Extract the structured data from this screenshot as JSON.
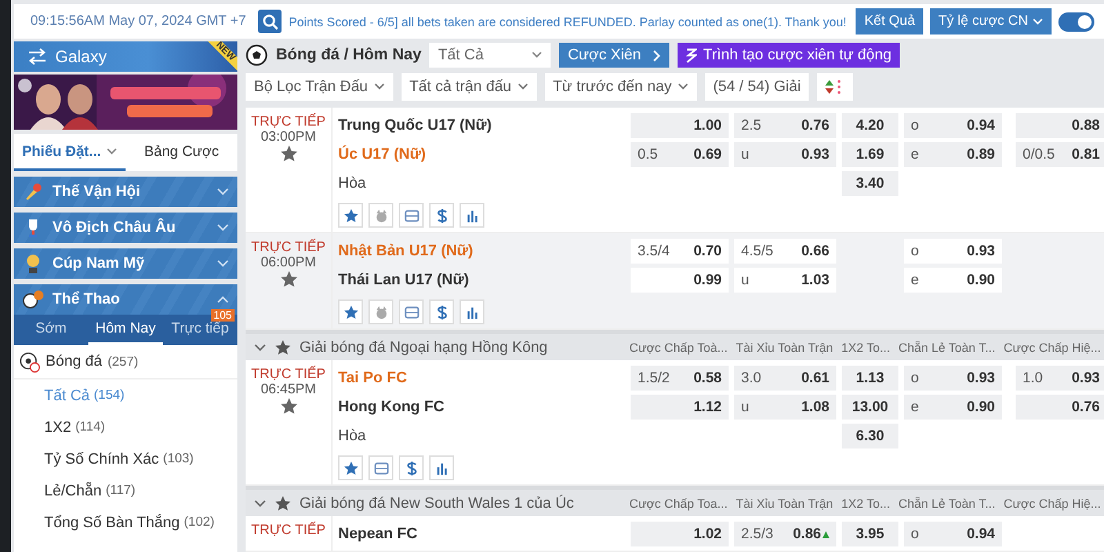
{
  "top_bar": {
    "clock": "09:15:56AM May 07, 2024 GMT +7",
    "ticker": "Points Scored - 6/5] all bets taken are considered REFUNDED. Parlay counted as one(1). Thank you!",
    "buttons": [
      {
        "label": "Kết Quả",
        "dropdown": false
      },
      {
        "label": "Tỷ lệ cược CN",
        "dropdown": true
      }
    ],
    "toggle": {
      "on": true
    }
  },
  "sidebar": {
    "galaxy": {
      "label": "Galaxy",
      "ribbon": "NEW"
    },
    "tabs": [
      {
        "label": "Phiếu Đặt...",
        "selected": true,
        "dropdown": true
      },
      {
        "label": "Bảng Cược",
        "selected": false,
        "dropdown": false
      }
    ],
    "categories": [
      {
        "label": "Thế Vận Hội",
        "expanded": false
      },
      {
        "label": "Vô Địch Châu Âu",
        "expanded": false
      },
      {
        "label": "Cúp Nam Mỹ",
        "expanded": false
      },
      {
        "label": "Thể Thao",
        "expanded": true
      }
    ],
    "sub_tabs": [
      {
        "label": "Sớm",
        "selected": false
      },
      {
        "label": "Hôm Nay",
        "selected": true
      },
      {
        "label": "Trực tiếp",
        "selected": false,
        "badge": "105"
      }
    ],
    "sport": {
      "name": "Bóng đá",
      "count": "(257)"
    },
    "markets": [
      {
        "name": "Tất Cả",
        "count": "(154)",
        "selected": true
      },
      {
        "name": "1X2",
        "count": "(114)",
        "selected": false
      },
      {
        "name": "Tỷ Số Chính Xác",
        "count": "(103)",
        "selected": false
      },
      {
        "name": "Lẻ/Chẵn",
        "count": "(117)",
        "selected": false
      },
      {
        "name": "Tổng Số Bàn Thắng",
        "count": "(102)",
        "selected": false
      }
    ]
  },
  "main": {
    "breadcrumb": "Bóng đá / Hôm Nay",
    "select": "Tất Cả",
    "parlay_button": "Cược Xiên",
    "auto_button": "Trình tạo cược xiên tự động",
    "filters": [
      {
        "label": "Bộ Lọc Trận Đấu",
        "dropdown": true
      },
      {
        "label": "Tất cả trận đấu",
        "dropdown": true
      },
      {
        "label": "Từ trước đến nay",
        "dropdown": true
      },
      {
        "label": "(54 / 54) Giải",
        "dropdown": false
      }
    ],
    "sections": [
      {
        "kind": "matches",
        "matches": [
          {
            "status": "TRỰC TIẾP",
            "time": "03:00PM",
            "teams": [
              {
                "name": "Trung Quốc U17 (Nữ)",
                "favourite": false
              },
              {
                "name": "Úc U17 (Nữ)",
                "favourite": true
              }
            ],
            "draw": "Hòa",
            "actions": [
              {
                "kind": "star"
              },
              {
                "kind": "mascot"
              },
              {
                "kind": "card"
              },
              {
                "kind": "dollar"
              },
              {
                "kind": "chart"
              }
            ],
            "rows": [
              [
                {
                  "odds": "1.00"
                },
                {
                  "line": "2.5",
                  "odds": "0.76"
                },
                {
                  "odds": "4.20"
                },
                {
                  "line": "o",
                  "odds": "0.94"
                },
                {
                  "odds": "0.88"
                }
              ],
              [
                {
                  "line": "0.5",
                  "odds": "0.69"
                },
                {
                  "line": "u",
                  "odds": "0.93"
                },
                {
                  "odds": "1.69"
                },
                {
                  "line": "e",
                  "odds": "0.89"
                },
                {
                  "line": "0/0.5",
                  "odds": "0.81"
                }
              ],
              [
                null,
                null,
                {
                  "odds": "3.40"
                },
                null,
                null
              ]
            ]
          },
          {
            "status": "TRỰC TIẾP",
            "time": "06:00PM",
            "teams": [
              {
                "name": "Nhật Bản U17 (Nữ)",
                "favourite": true
              },
              {
                "name": "Thái Lan U17 (Nữ)",
                "favourite": false
              }
            ],
            "actions": [
              {
                "kind": "star"
              },
              {
                "kind": "mascot"
              },
              {
                "kind": "card"
              },
              {
                "kind": "dollar"
              },
              {
                "kind": "chart"
              }
            ],
            "rows": [
              [
                {
                  "line": "3.5/4",
                  "odds": "0.70"
                },
                {
                  "line": "4.5/5",
                  "odds": "0.66"
                },
                null,
                {
                  "line": "o",
                  "odds": "0.93"
                },
                null
              ],
              [
                {
                  "odds": "0.99"
                },
                {
                  "line": "u",
                  "odds": "1.03"
                },
                null,
                {
                  "line": "e",
                  "odds": "0.90"
                },
                null
              ]
            ]
          }
        ]
      },
      {
        "kind": "league",
        "name": "Giải bóng đá Ngoại hạng Hồng Kông",
        "columns": [
          "Cược Chấp Toà...",
          "Tài Xỉu Toàn Trận",
          "1X2 To...",
          "Chẵn Lẻ Toàn T...",
          "Cược Chấp Hiệ..."
        ],
        "matches": [
          {
            "status": "TRỰC TIẾP",
            "time": "06:45PM",
            "teams": [
              {
                "name": "Tai Po FC",
                "favourite": true
              },
              {
                "name": "Hong Kong FC",
                "favourite": false
              }
            ],
            "draw": "Hòa",
            "actions": [
              {
                "kind": "star"
              },
              {
                "kind": "card"
              },
              {
                "kind": "dollar"
              },
              {
                "kind": "chart"
              }
            ],
            "rows": [
              [
                {
                  "line": "1.5/2",
                  "odds": "0.58"
                },
                {
                  "line": "3.0",
                  "odds": "0.61"
                },
                {
                  "odds": "1.13"
                },
                {
                  "line": "o",
                  "odds": "0.93"
                },
                {
                  "line": "1.0",
                  "odds": "0.93"
                }
              ],
              [
                {
                  "odds": "1.12"
                },
                {
                  "line": "u",
                  "odds": "1.08"
                },
                {
                  "odds": "13.00"
                },
                {
                  "line": "e",
                  "odds": "0.90"
                },
                {
                  "odds": "0.76"
                }
              ],
              [
                null,
                null,
                {
                  "odds": "6.30"
                },
                null,
                null
              ]
            ]
          }
        ]
      },
      {
        "kind": "league",
        "name": "Giải bóng đá New South Wales 1 của Úc",
        "columns": [
          "Cược Chấp Toa...",
          "Tài Xỉu Toàn Trận",
          "1X2 To...",
          "Chẵn Lẻ Toàn T...",
          "Cược Chấp Hiệ..."
        ],
        "matches": [
          {
            "status": "TRỰC TIẾP",
            "teams": [
              {
                "name": "Nepean FC",
                "favourite": false
              }
            ],
            "rows": [
              [
                {
                  "odds": "1.02"
                },
                {
                  "line": "2.5/3",
                  "odds": "0.86",
                  "rising": true
                },
                {
                  "odds": "3.95"
                },
                {
                  "line": "o",
                  "odds": "0.94"
                },
                null
              ]
            ]
          }
        ]
      }
    ]
  }
}
